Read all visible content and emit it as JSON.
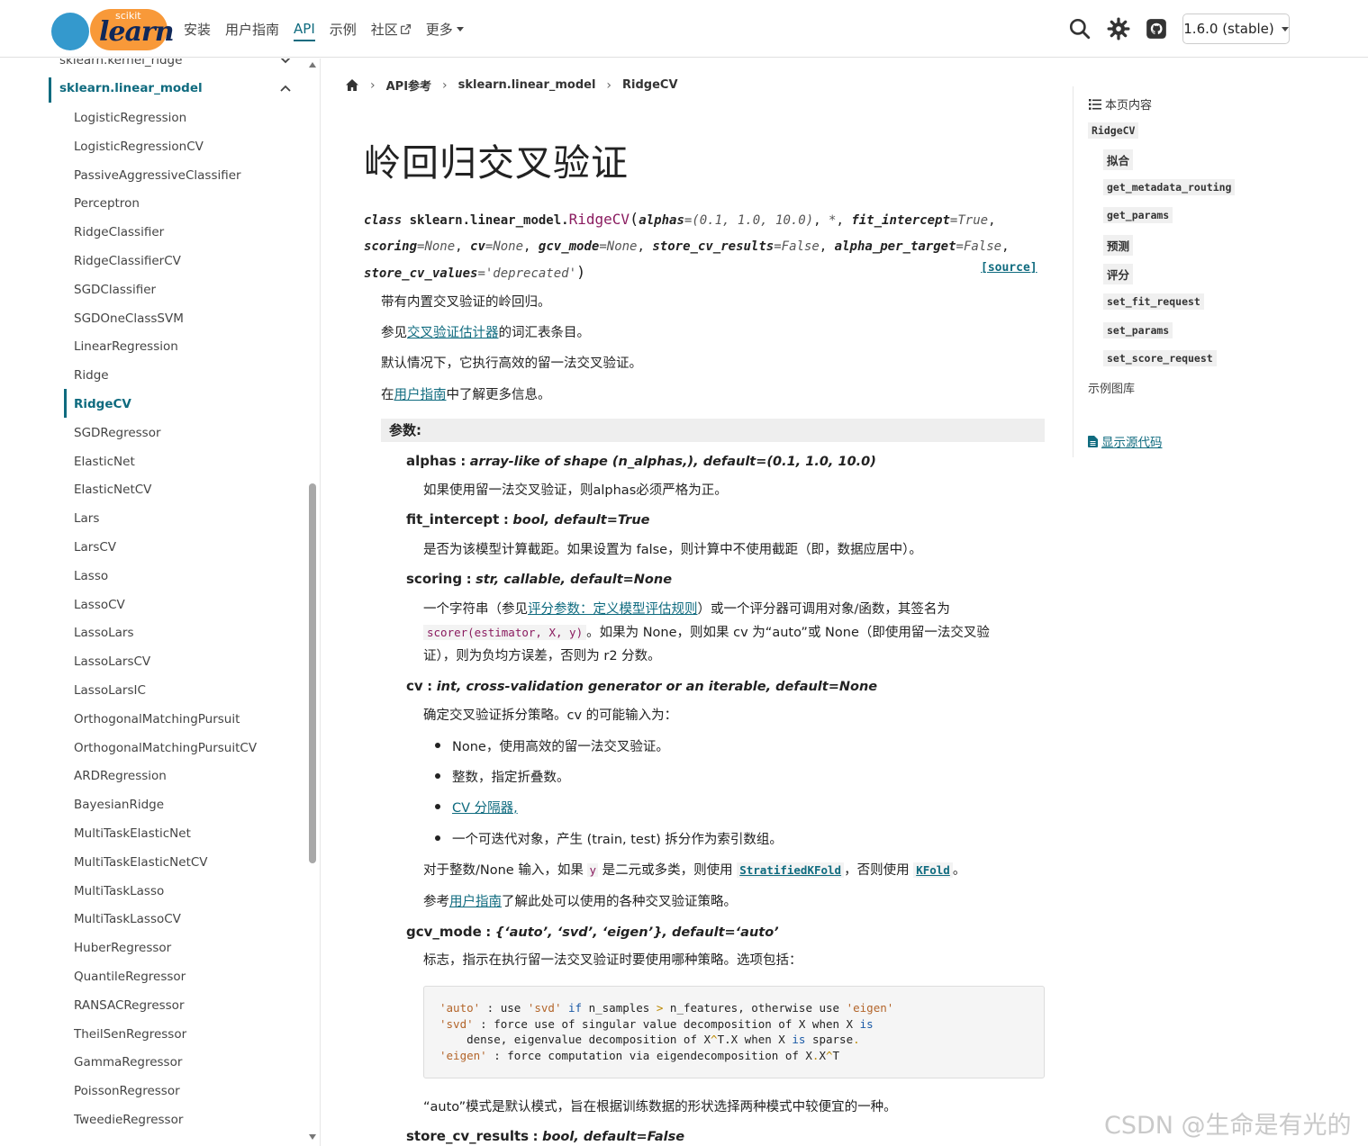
{
  "navbar": {
    "logo_small": "scikit",
    "logo_big": "learn",
    "links": [
      {
        "label": "安装"
      },
      {
        "label": "用户指南"
      },
      {
        "label": "API"
      },
      {
        "label": "示例"
      },
      {
        "label": "社区"
      },
      {
        "label": "更多"
      }
    ],
    "version": "1.6.0 (stable)"
  },
  "sidebar": {
    "groups": [
      {
        "label": "sklearn.kernel_ridge"
      },
      {
        "label": "sklearn.linear_model"
      }
    ],
    "items": [
      "LogisticRegression",
      "LogisticRegressionCV",
      "PassiveAggressiveClassifier",
      "Perceptron",
      "RidgeClassifier",
      "RidgeClassifierCV",
      "SGDClassifier",
      "SGDOneClassSVM",
      "LinearRegression",
      "Ridge",
      "RidgeCV",
      "SGDRegressor",
      "ElasticNet",
      "ElasticNetCV",
      "Lars",
      "LarsCV",
      "Lasso",
      "LassoCV",
      "LassoLars",
      "LassoLarsCV",
      "LassoLarsIC",
      "OrthogonalMatchingPursuit",
      "OrthogonalMatchingPursuitCV",
      "ARDRegression",
      "BayesianRidge",
      "MultiTaskElasticNet",
      "MultiTaskElasticNetCV",
      "MultiTaskLasso",
      "MultiTaskLassoCV",
      "HuberRegressor",
      "QuantileRegressor",
      "RANSACRegressor",
      "TheilSenRegressor",
      "GammaRegressor",
      "PoissonRegressor",
      "TweedieRegressor"
    ]
  },
  "breadcrumb": {
    "b1": "API参考",
    "b2": "sklearn.linear_model",
    "b3": "RidgeCV"
  },
  "main": {
    "title": "岭回归交叉验证",
    "sig": {
      "class_kw": "class",
      "module": "sklearn.linear_model.",
      "cls": "RidgeCV",
      "line1_rest": "alphas",
      "alphas_default": "=(0.1, 1.0, 10.0)",
      "star": "*",
      "fit_intercept": "fit_intercept",
      "fit_intercept_default": "=True",
      "scoring": "scoring",
      "scoring_default": "=None",
      "cv": "cv",
      "cv_default": "=None",
      "gcv_mode": "gcv_mode",
      "gcv_mode_default": "=None",
      "store_cv_results": "store_cv_results",
      "store_cv_results_default": "=False",
      "alpha_per_target": "alpha_per_target",
      "alpha_per_target_default": "=False",
      "store_cv_values": "store_cv_values",
      "store_cv_values_default": "='deprecated'",
      "source": "[source]"
    },
    "desc1": "带有内置交叉验证的岭回归。",
    "desc2_pre": "参见",
    "desc2_link": "交叉验证估计器",
    "desc2_post": "的词汇表条目。",
    "desc3": "默认情况下，它执行高效的留一法交叉验证。",
    "desc4_pre": "在",
    "desc4_link": "用户指南",
    "desc4_post": "中了解更多信息。",
    "params_heading": "参数:",
    "p_alphas": {
      "name": "alphas",
      "type": "array-like of shape (n_alphas,), default=(0.1, 1.0, 10.0)",
      "desc": "如果使用留一法交叉验证，则alphas必须严格为正。"
    },
    "p_fit": {
      "name": "fit_intercept",
      "type": "bool, default=True",
      "desc": "是否为该模型计算截距。如果设置为 false，则计算中不使用截距（即，数据应居中）。"
    },
    "p_scoring": {
      "name": "scoring",
      "type": "str, callable, default=None",
      "d1_pre": "一个字符串（参见",
      "d1_link": "评分参数：定义模型评估规则",
      "d1_post": "）或一个评分器可调用对象/函数，其签名为",
      "d2_code": "scorer(estimator, X, y)",
      "d2_post": "。如果为 None，则如果 cv 为“auto”或 None（即使用留一法交叉验",
      "d3": "证），则为负均方误差，否则为 r2 分数。"
    },
    "p_cv": {
      "name": "cv",
      "type": "int, cross-validation generator or an iterable, default=None",
      "desc": "确定交叉验证拆分策略。cv 的可能输入为：",
      "bullets": [
        "None，使用高效的留一法交叉验证。",
        "整数，指定折叠数。",
        "CV 分隔器,",
        "一个可迭代对象，产生 (train, test) 拆分作为索引数组。"
      ],
      "n1_pre": "对于整数/None 输入，如果",
      "n1_y": "y",
      "n1_mid": "是二元或多类，则使用",
      "n1_code1": "StratifiedKFold",
      "n1_mid2": "，否则使用",
      "n1_code2": "KFold",
      "n1_post": "。",
      "n2_pre": "参考",
      "n2_link": "用户指南",
      "n2_post": "了解此处可以使用的各种交叉验证策略。"
    },
    "p_gcv": {
      "name": "gcv_mode",
      "type": "{‘auto’, ‘svd’, ‘eigen’}, default=‘auto’",
      "desc": "标志，指示在执行留一法交叉验证时要使用哪种策略。选项包括：",
      "after": "“auto”模式是默认模式，旨在根据训练数据的形状选择两种模式中较便宜的一种。"
    },
    "p_store": {
      "name": "store_cv_results",
      "type": "bool, default=False"
    }
  },
  "toc": {
    "title": "本页内容",
    "items": [
      "RidgeCV",
      "拟合",
      "get_metadata_routing",
      "get_params",
      "预测",
      "评分",
      "set_fit_request",
      "set_params",
      "set_score_request"
    ],
    "gallery": "示例图库",
    "show_source": "显示源代码"
  },
  "watermark": "CSDN @生命是有光的"
}
